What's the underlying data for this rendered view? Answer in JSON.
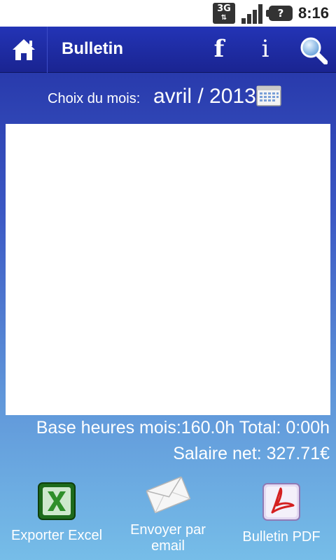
{
  "status_bar": {
    "network_label": "3G",
    "network_arrows": "⇅",
    "battery_label": "?",
    "clock": "8:16"
  },
  "action_bar": {
    "title": "Bulletin",
    "facebook_glyph": "f",
    "info_glyph": "i"
  },
  "month_chooser": {
    "label": "Choix du mois:",
    "value": "avril / 2013"
  },
  "summary": {
    "hours_line": "Base heures mois:160.0h Total: 0:00h",
    "salary_line": "Salaire net: 327.71€"
  },
  "actions": {
    "excel_label": "Exporter Excel",
    "email_label_line1": "Envoyer par",
    "email_label_line2": "email",
    "pdf_label": "Bulletin PDF"
  },
  "colors": {
    "action_bar": "#1f2ca3",
    "excel_green": "#2f8f2a",
    "pdf_red": "#d42020"
  }
}
